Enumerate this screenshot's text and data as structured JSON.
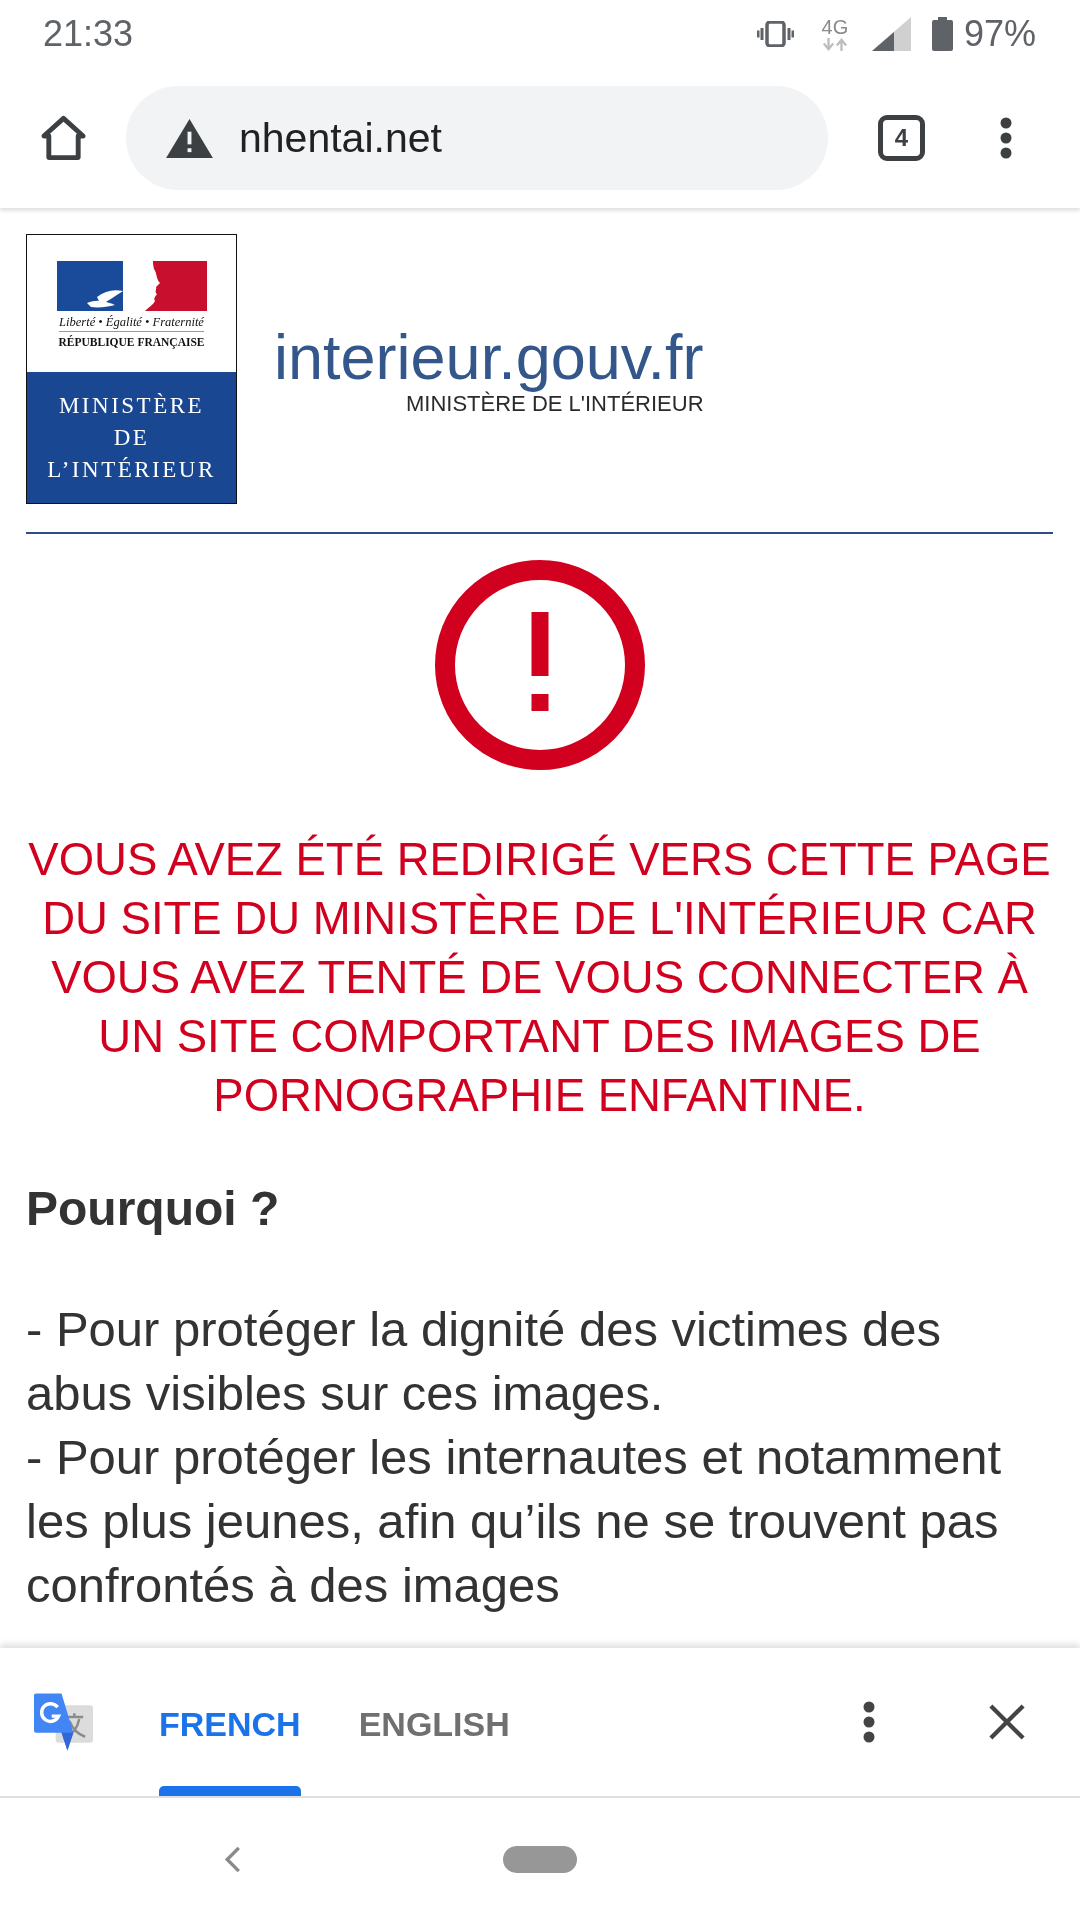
{
  "status_bar": {
    "time": "21:33",
    "network": "4G",
    "battery": "97%"
  },
  "browser_toolbar": {
    "url": "nhentai.net",
    "tab_count": "4"
  },
  "page": {
    "logo": {
      "motto": "Liberté • Égalité • Fraternité",
      "republic": "RÉPUBLIQUE FRANÇAISE",
      "ministry": "MINISTÈRE DE L’INTÉRIEUR"
    },
    "site_name": "interieur.gouv.fr",
    "site_tagline": "MINISTÈRE DE L'INTÉRIEUR",
    "alert": "VOUS AVEZ ÉTÉ REDIRIGÉ VERS CETTE PAGE DU SITE DU MINISTÈRE DE L'INTÉRIEUR CAR VOUS AVEZ TENTÉ DE VOUS CONNECTER À UN SITE COMPORTANT DES IMAGES DE PORNOGRAPHIE ENFANTINE.",
    "heading": "Pourquoi ?",
    "reasons": [
      "- Pour protéger la dignité des victimes des abus visibles sur ces images.",
      "- Pour protéger les internautes et notamment les plus jeunes, afin qu’ils ne se trouvent pas confrontés à des images"
    ]
  },
  "translate_bar": {
    "languages": [
      {
        "label": "FRENCH",
        "selected": true
      },
      {
        "label": "ENGLISH",
        "selected": false
      }
    ]
  }
}
